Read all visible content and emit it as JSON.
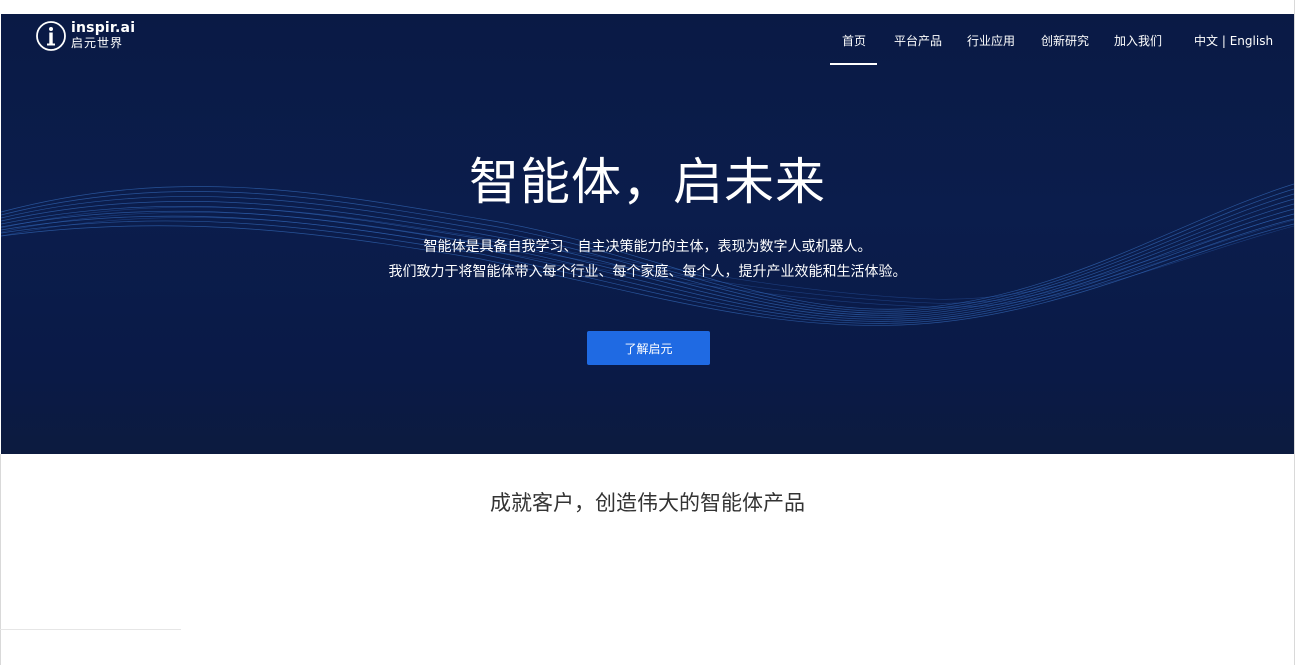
{
  "brand": {
    "name_en": "inspir.ai",
    "name_cn": "启元世界"
  },
  "nav": {
    "items": [
      {
        "label": "首页",
        "active": true
      },
      {
        "label": "平台产品"
      },
      {
        "label": "行业应用"
      },
      {
        "label": "创新研究"
      },
      {
        "label": "加入我们"
      }
    ],
    "lang_cn": "中文",
    "lang_sep": "|",
    "lang_en": "English"
  },
  "hero": {
    "title": "智能体，启未来",
    "line1": "智能体是具备自我学习、自主决策能力的主体，表现为数字人或机器人。",
    "line2": "我们致力于将智能体带入每个行业、每个家庭、每个人，提升产业效能和生活体验。",
    "cta_label": "了解启元"
  },
  "section": {
    "title": "成就客户，创造伟大的智能体产品"
  },
  "colors": {
    "hero_bg": "#0a1a45",
    "cta": "#1f6ae3",
    "wave": "#3f7fd8"
  }
}
